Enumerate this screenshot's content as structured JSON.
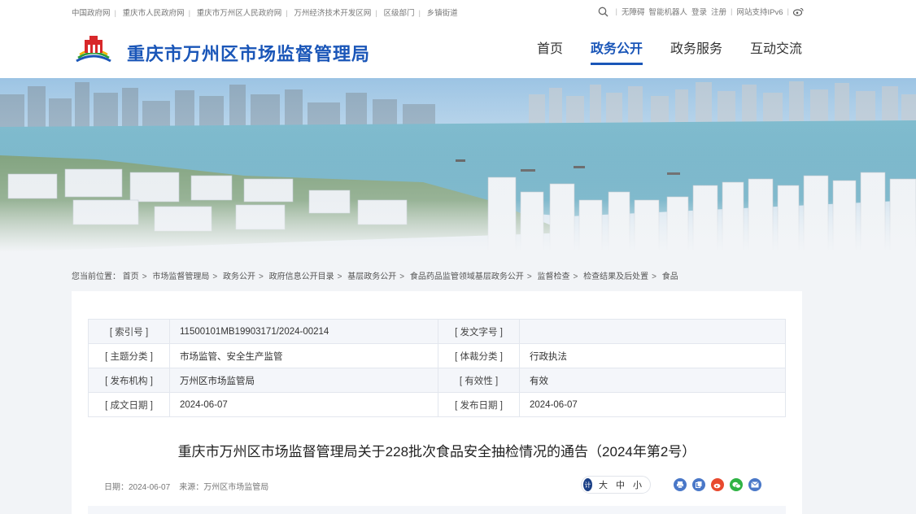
{
  "topbar": {
    "links": [
      "中国政府网",
      "重庆市人民政府网",
      "重庆市万州区人民政府网",
      "万州经济技术开发区网",
      "区级部门",
      "乡镇街道"
    ],
    "accessibility": "无障碍",
    "robot": "智能机器人",
    "login": "登录",
    "register": "注册",
    "ipv6": "网站支持IPv6"
  },
  "header": {
    "site_title": "重庆市万州区市场监督管理局",
    "nav": [
      "首页",
      "政务公开",
      "政务服务",
      "互动交流"
    ],
    "active_nav": "政务公开"
  },
  "breadcrumb": {
    "prefix": "您当前位置：",
    "items": [
      "首页",
      "市场监督管理局",
      "政务公开",
      "政府信息公开目录",
      "基层政务公开",
      "食品药品监管领域基层政务公开",
      "监督检查",
      "检查结果及后处置",
      "食品"
    ]
  },
  "meta": {
    "rows": [
      {
        "l1": "[ 索引号 ]",
        "v1": "11500101MB19903171/2024-00214",
        "l2": "[ 发文字号 ]",
        "v2": ""
      },
      {
        "l1": "[ 主题分类 ]",
        "v1": "市场监管、安全生产监管",
        "l2": "[ 体裁分类 ]",
        "v2": "行政执法"
      },
      {
        "l1": "[ 发布机构 ]",
        "v1": "万州区市场监管局",
        "l2": "[ 有效性 ]",
        "v2": "有效"
      },
      {
        "l1": "[ 成文日期 ]",
        "v1": "2024-06-07",
        "l2": "[ 发布日期 ]",
        "v2": "2024-06-07"
      }
    ]
  },
  "article": {
    "title": "重庆市万州区市场监督管理局关于228批次食品安全抽检情况的通告（2024年第2号）",
    "date": "日期：2024-06-07",
    "source": "来源：万州区市场监管局",
    "font_badge": "计",
    "font_sizes": [
      "大",
      "中",
      "小"
    ]
  },
  "colors": {
    "brand": "#1a56b8",
    "share": [
      "#4a78c8",
      "#4a78c8",
      "#e8492e",
      "#2fb344",
      "#4a78c8"
    ]
  },
  "icons": {
    "share": [
      "print-icon",
      "copy-icon",
      "weibo-icon",
      "wechat-icon",
      "email-icon"
    ]
  }
}
